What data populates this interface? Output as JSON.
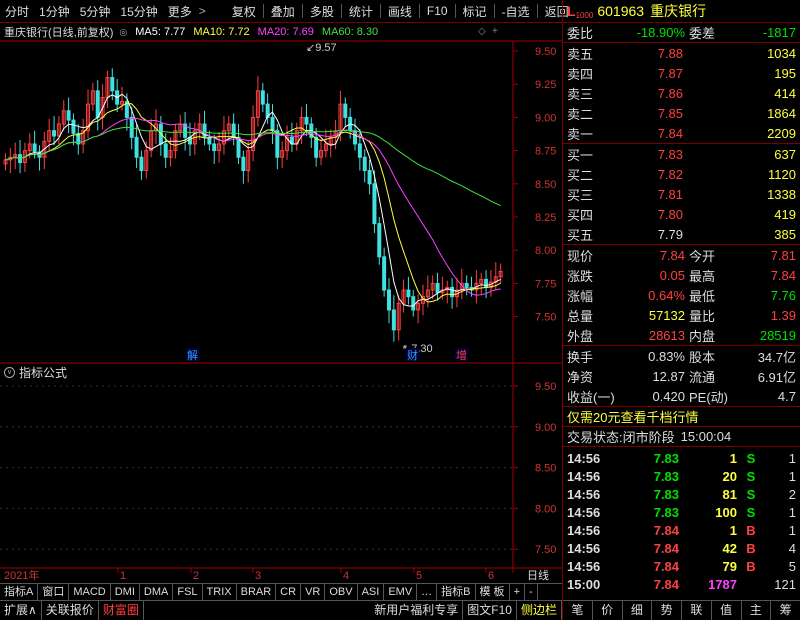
{
  "toolbar": {
    "items": [
      "分时",
      "1分钟",
      "5分钟",
      "15分钟",
      "更多",
      "复权",
      "叠加",
      "多股",
      "统计",
      "画线",
      "F10",
      "标记",
      "-自选",
      "返回"
    ],
    "more_arrow": ">"
  },
  "chart": {
    "title": "重庆银行(日线,前复权)",
    "ma5": "MA5: 7.77",
    "ma10": "MA10: 7.72",
    "ma20": "MA20: 7.69",
    "ma60": "MA60: 8.30",
    "high_label": "9.57",
    "low_label": "7.30",
    "markers": [
      "解",
      "财",
      "增"
    ],
    "price_axis": [
      "9.50",
      "9.25",
      "9.00",
      "8.75",
      "8.50",
      "8.25",
      "8.00",
      "7.75",
      "7.50"
    ],
    "ind_axis": [
      "9.50",
      "9.00",
      "8.50",
      "8.00",
      "7.50"
    ],
    "x_axis": [
      "2021年",
      "1",
      "2",
      "3",
      "4",
      "5",
      "6",
      "日线"
    ],
    "indicator_label": "指标公式",
    "ma_colors": {
      "ma5": "#ffffff",
      "ma10": "#ffff40",
      "ma20": "#ff40ff",
      "ma60": "#40e040"
    }
  },
  "chart_data": {
    "type": "candlestick",
    "note_series": [
      "MA5",
      "MA10",
      "MA20",
      "MA60"
    ],
    "ylim": [
      7.3,
      9.6
    ],
    "high": 9.57,
    "low": 7.3
  },
  "bottom_tabs1": [
    "指标A",
    "窗口",
    "MACD",
    "DMI",
    "DMA",
    "FSL",
    "TRIX",
    "BRAR",
    "CR",
    "VR",
    "OBV",
    "ASI",
    "EMV",
    "…",
    "指标B",
    "模 板",
    "+",
    "-"
  ],
  "bottom_tabs2": [
    "扩展∧",
    "关联报价",
    "财富圈",
    "新用户福利专享",
    "图文F10",
    "侧边栏"
  ],
  "panel": {
    "code": "601963",
    "name": "重庆银行",
    "l_label": "L",
    "level": "1000",
    "webi": "委比",
    "webi_val": "-18.90%",
    "wecha": "委差",
    "wecha_val": "-1817",
    "sell": [
      {
        "l": "卖五",
        "p": "7.88",
        "v": "1034"
      },
      {
        "l": "卖四",
        "p": "7.87",
        "v": "195"
      },
      {
        "l": "卖三",
        "p": "7.86",
        "v": "414"
      },
      {
        "l": "卖二",
        "p": "7.85",
        "v": "1864"
      },
      {
        "l": "卖一",
        "p": "7.84",
        "v": "2209"
      }
    ],
    "buy": [
      {
        "l": "买一",
        "p": "7.83",
        "v": "637"
      },
      {
        "l": "买二",
        "p": "7.82",
        "v": "1120"
      },
      {
        "l": "买三",
        "p": "7.81",
        "v": "1338"
      },
      {
        "l": "买四",
        "p": "7.80",
        "v": "419"
      },
      {
        "l": "买五",
        "p": "7.79",
        "v": "385"
      }
    ],
    "stats": [
      {
        "a": "现价",
        "av": "7.84",
        "b": "今开",
        "bv": "7.81"
      },
      {
        "a": "涨跌",
        "av": "0.05",
        "b": "最高",
        "bv": "7.84"
      },
      {
        "a": "涨幅",
        "av": "0.64%",
        "b": "最低",
        "bv": "7.76"
      },
      {
        "a": "总量",
        "av": "57132",
        "b": "量比",
        "bv": "1.39"
      },
      {
        "a": "外盘",
        "av": "28613",
        "b": "内盘",
        "bv": "28519"
      }
    ],
    "stats2": [
      {
        "a": "换手",
        "av": "0.83%",
        "b": "股本",
        "bv": "34.7亿"
      },
      {
        "a": "净资",
        "av": "12.87",
        "b": "流通",
        "bv": "6.91亿"
      },
      {
        "a": "收益(一)",
        "av": "0.420",
        "b": "PE(动)",
        "bv": "4.7"
      }
    ],
    "promo": "仅需20元查看千档行情",
    "status_label": "交易状态:",
    "status_val": "闭市阶段",
    "status_time": "15:00:04",
    "ticks": [
      {
        "t": "14:56",
        "p": "7.83",
        "v": "1",
        "s": "S",
        "n": "1"
      },
      {
        "t": "14:56",
        "p": "7.83",
        "v": "20",
        "s": "S",
        "n": "1"
      },
      {
        "t": "14:56",
        "p": "7.83",
        "v": "81",
        "s": "S",
        "n": "2"
      },
      {
        "t": "14:56",
        "p": "7.83",
        "v": "100",
        "s": "S",
        "n": "1"
      },
      {
        "t": "14:56",
        "p": "7.84",
        "v": "1",
        "s": "B",
        "n": "1"
      },
      {
        "t": "14:56",
        "p": "7.84",
        "v": "42",
        "s": "B",
        "n": "4"
      },
      {
        "t": "14:56",
        "p": "7.84",
        "v": "79",
        "s": "B",
        "n": "5"
      },
      {
        "t": "15:00",
        "p": "7.84",
        "v": "1787",
        "s": "",
        "n": "121"
      }
    ],
    "nav": [
      "笔",
      "价",
      "细",
      "势",
      "联",
      "值",
      "主",
      "筹"
    ]
  }
}
